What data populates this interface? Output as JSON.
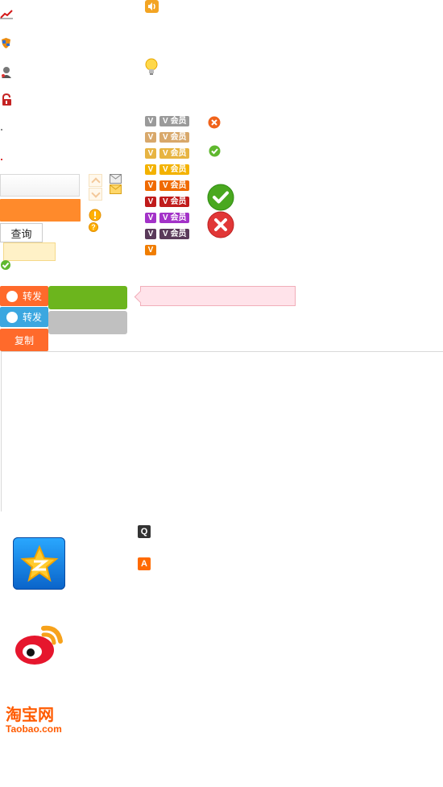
{
  "query_label": "查询",
  "member_label": "会员",
  "share": {
    "weibo_label": "转发",
    "tencent_label": "转发",
    "copy_label": "复制"
  },
  "logos": {
    "taobao_cn": "淘宝网",
    "taobao_en": "Taobao.com"
  },
  "keys": {
    "q": "Q",
    "a": "A"
  },
  "colors": {
    "orange": "#ff7a1a",
    "green": "#6cb51d",
    "grey": "#bcbcbc",
    "weibo_red": "#e6162d",
    "taobao_orange": "#ff5b00"
  },
  "icons": [
    "chart-line-icon",
    "shield-icon",
    "user-icon",
    "lock-icon",
    "speaker-icon",
    "lightbulb-icon",
    "error-circle-icon",
    "check-circle-icon",
    "mail-icon",
    "warning-icon",
    "help-icon"
  ]
}
